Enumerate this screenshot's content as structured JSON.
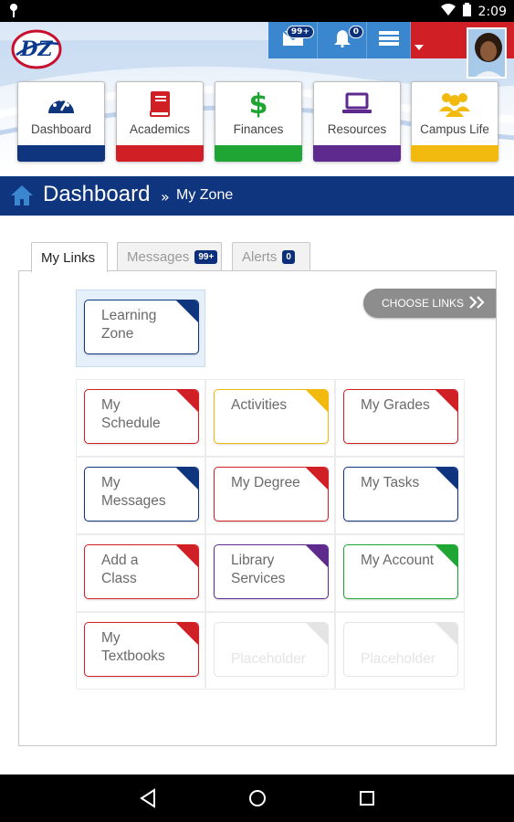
{
  "status_bar": {
    "time": "2:09",
    "left_icon": "pin-icon",
    "right_icons": [
      "wifi-icon",
      "battery-icon"
    ]
  },
  "header": {
    "logo_text": "DZ",
    "toolbar": {
      "messages_count": "99+",
      "alerts_count": "0"
    },
    "nav": [
      {
        "label": "Dashboard",
        "icon": "speedometer-icon",
        "color": "#10357f"
      },
      {
        "label": "Academics",
        "icon": "book-icon",
        "color": "#d11f26"
      },
      {
        "label": "Finances",
        "icon": "dollar-icon",
        "color": "#1fa534"
      },
      {
        "label": "Resources",
        "icon": "laptop-icon",
        "color": "#5e2a8e"
      },
      {
        "label": "Campus Life",
        "icon": "people-icon",
        "color": "#f2b90f"
      }
    ]
  },
  "banner": {
    "title": "Dashboard",
    "separator": "»",
    "subtitle": "My Zone"
  },
  "tabs": [
    {
      "label": "My Links",
      "count": ""
    },
    {
      "label": "Messages",
      "count": "99+"
    },
    {
      "label": "Alerts",
      "count": "0"
    }
  ],
  "choose_links_label": "CHOOSE LINKS",
  "links": [
    {
      "label": "Learning Zone",
      "color": "#10357f"
    },
    {
      "label": "My Schedule",
      "color": "#d11f26"
    },
    {
      "label": "Activities",
      "color": "#f2b90f"
    },
    {
      "label": "My Grades",
      "color": "#d11f26"
    },
    {
      "label": "My Messages",
      "color": "#10357f"
    },
    {
      "label": "My Degree",
      "color": "#d11f26"
    },
    {
      "label": "My Tasks",
      "color": "#10357f"
    },
    {
      "label": "Add a Class",
      "color": "#d11f26"
    },
    {
      "label": "Library Services",
      "color": "#5e2a8e"
    },
    {
      "label": "My Account",
      "color": "#1fa534"
    },
    {
      "label": "My Textbooks",
      "color": "#d11f26"
    },
    {
      "label": "Placeholder",
      "color": "#e4e4e4"
    },
    {
      "label": "Placeholder",
      "color": "#e4e4e4"
    }
  ],
  "colors": {
    "brand_blue": "#10357f",
    "toolbar_blue": "#3a86cf",
    "brand_red": "#d11f26"
  }
}
